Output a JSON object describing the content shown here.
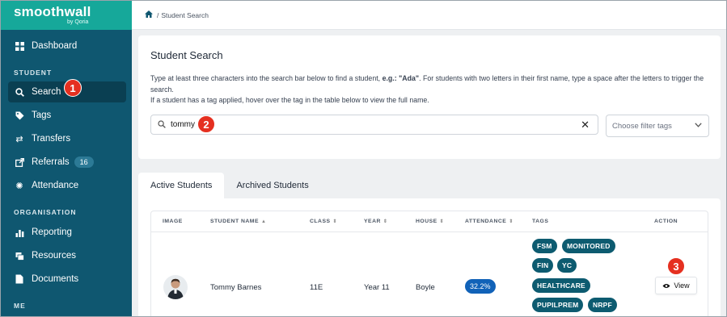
{
  "brand": {
    "name": "smoothwall",
    "sub": "by Qoria"
  },
  "sidebar": {
    "dashboard": "Dashboard",
    "section_student": "STUDENT",
    "search": "Search",
    "tags": "Tags",
    "transfers": "Transfers",
    "referrals": "Referrals",
    "referrals_count": "16",
    "attendance": "Attendance",
    "section_organisation": "ORGANISATION",
    "reporting": "Reporting",
    "resources": "Resources",
    "documents": "Documents",
    "section_me": "ME"
  },
  "breadcrumb": {
    "separator": "/",
    "current": "Student Search"
  },
  "search_card": {
    "title": "Student Search",
    "hint_prefix": "Type at least three characters into the search bar below to find a student, ",
    "hint_example": "e.g.: \"Ada\"",
    "hint_suffix": ". For students with two letters in their first name, type a space after the letters to trigger the search.",
    "hint_line2": "If a student has a tag applied, hover over the tag in the table below to view the full name.",
    "search_value": "tommy",
    "filter_placeholder": "Choose filter tags"
  },
  "tabs": {
    "active": "Active Students",
    "archived": "Archived Students"
  },
  "table": {
    "headers": [
      "IMAGE",
      "STUDENT NAME",
      "CLASS",
      "YEAR",
      "HOUSE",
      "ATTENDANCE",
      "TAGS",
      "ACTION"
    ],
    "row": {
      "name": "Tommy Barnes",
      "class": "11E",
      "year": "Year 11",
      "house": "Boyle",
      "attendance": "32.2%",
      "tags": [
        "FSM",
        "MONITORED",
        "FIN",
        "YC",
        "HEALTHCARE",
        "PUPILPREM",
        "NRPF"
      ],
      "action": "View"
    }
  },
  "callouts": [
    "1",
    "2",
    "3"
  ],
  "colors": {
    "sidebar": "#0f5770",
    "brand": "#16a89a",
    "tag": "#0d5b70",
    "attendance": "#1162b8",
    "callout": "#e53020"
  }
}
